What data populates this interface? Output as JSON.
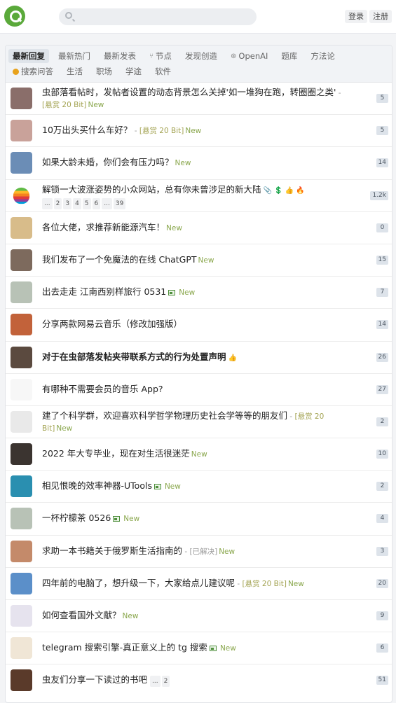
{
  "header": {
    "search_placeholder": "",
    "login_label": "登录",
    "register_label": "注册"
  },
  "tabs_row1": [
    {
      "label": "最新回复",
      "active": true,
      "icon": ""
    },
    {
      "label": "最新热门",
      "active": false,
      "icon": ""
    },
    {
      "label": "最新发表",
      "active": false,
      "icon": ""
    },
    {
      "label": "节点",
      "active": false,
      "icon": "branch-icon"
    },
    {
      "label": "发现创造",
      "active": false,
      "icon": ""
    },
    {
      "label": "OpenAI",
      "active": false,
      "icon": "openai-icon"
    },
    {
      "label": "题库",
      "active": false,
      "icon": ""
    },
    {
      "label": "方法论",
      "active": false,
      "icon": ""
    }
  ],
  "tabs_row2": [
    {
      "label": "搜索问答",
      "active": false,
      "icon": "bitcoin-icon"
    },
    {
      "label": "生活",
      "active": false,
      "icon": ""
    },
    {
      "label": "职场",
      "active": false,
      "icon": ""
    },
    {
      "label": "学途",
      "active": false,
      "icon": ""
    },
    {
      "label": "软件",
      "active": false,
      "icon": ""
    }
  ],
  "topics": [
    {
      "title": "虫部落看帖时，发帖者设置的动态背景怎么关掉'如一堆狗在跑，转圈圈之类'",
      "extra": " - ",
      "bounty": "[悬赏 20 Bit]",
      "new": "New",
      "count": "5",
      "two_line": true,
      "avatar_color": "#8a6e6a"
    },
    {
      "title": "10万出头买什么车好？",
      "extra": " - ",
      "bounty": "[悬赏 20 Bit]",
      "new": "New",
      "count": "5",
      "avatar_color": "#c9a29a"
    },
    {
      "title": "如果大龄未婚，你们会有压力吗？",
      "new": "New",
      "count": "14",
      "avatar_color": "#6b8db6"
    },
    {
      "title": "解锁一大波涨姿势的小众网站，总有你未曾涉足的新大陆",
      "icons": "📎 💲 👍 🔥",
      "pages": [
        "...",
        "2",
        "3",
        "4",
        "5",
        "6",
        "...",
        "39"
      ],
      "count": "1.2k",
      "avatar_color": "#ffffff",
      "apple": true
    },
    {
      "title": "各位大佬，求推荐新能源汽车！",
      "new": "New",
      "count": "0",
      "avatar_color": "#d8bc8a"
    },
    {
      "title": "我们发布了一个免魔法的在线 ChatGPT",
      "new": "New",
      "count": "15",
      "avatar_color": "#7d6a5d"
    },
    {
      "title": "出去走走 江南西别样旅行 0531",
      "pic": true,
      "new": "New",
      "count": "7",
      "avatar_color": "#b8c2b6"
    },
    {
      "title": "分享两款网易云音乐（修改加强版）",
      "count": "14",
      "avatar_color": "#c2623a"
    },
    {
      "title": "对于在虫部落发帖夹带联系方式的行为处置声明",
      "bold": true,
      "icons": "👍",
      "count": "26",
      "avatar_color": "#5b4a3f"
    },
    {
      "title": "有哪种不需要会员的音乐 App?",
      "count": "27",
      "avatar_color": "#f7f7f7"
    },
    {
      "title": "建了个科学群，欢迎喜欢科学哲学物理历史社会学等等的朋友们",
      "extra": " - ",
      "bounty": "[悬赏 20 Bit]",
      "new": "New",
      "count": "2",
      "two_line": true,
      "avatar_color": "#e9e9e9"
    },
    {
      "title": "2022 年大专毕业，现在对生活很迷茫",
      "new": "New",
      "count": "10",
      "avatar_color": "#3b3430"
    },
    {
      "title": "相见恨晚的效率神器-UTools",
      "pic": true,
      "new": "New",
      "count": "2",
      "avatar_color": "#2a8fb0"
    },
    {
      "title": "一杯柠檬茶 0526",
      "pic": true,
      "new": "New",
      "count": "4",
      "avatar_color": "#b8c2b6"
    },
    {
      "title": "求助一本书籍关于俄罗斯生活指南的",
      "extra": " - [已解决]",
      "new": "New",
      "count": "3",
      "avatar_color": "#c48a6a"
    },
    {
      "title": "四年前的电脑了，想升级一下，大家给点儿建议呢",
      "extra": " - ",
      "bounty": "[悬赏 20 Bit]",
      "new": "New",
      "count": "20",
      "avatar_color": "#5b8fc9"
    },
    {
      "title": "如何查看国外文献？",
      "new": "New",
      "count": "9",
      "avatar_color": "#e6e3ee"
    },
    {
      "title": "telegram 搜索引擎-真正意义上的 tg 搜索",
      "pic": true,
      "new": "New",
      "count": "6",
      "avatar_color": "#f0e6d6"
    },
    {
      "title": "虫友们分享一下读过的书吧",
      "pages": [
        "...",
        "2"
      ],
      "inline_pages": true,
      "count": "51",
      "avatar_color": "#5a3a2a"
    }
  ]
}
